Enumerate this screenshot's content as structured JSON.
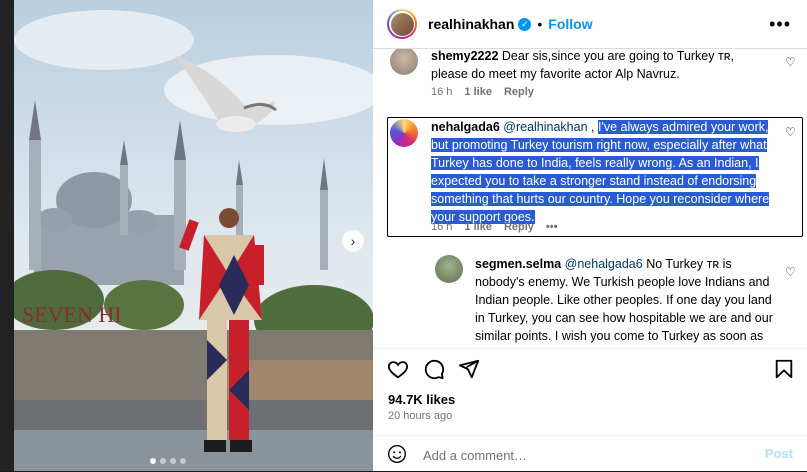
{
  "header": {
    "username": "realhinakhan",
    "separator": "•",
    "follow_label": "Follow",
    "more_label": "•••"
  },
  "media": {
    "next_icon": "chevron-right-icon",
    "sign_text": "SEVEN HI"
  },
  "comments": [
    {
      "username": "shemy2222",
      "text": "Dear sis,since you are going to Turkey ᴛʀ, please do meet my favorite actor Alp Navruz.",
      "time": "16 h",
      "likes": "1 like",
      "reply": "Reply"
    },
    {
      "username": "nehalgada6",
      "mention": "@realhinakhan",
      "separator": " , ",
      "text": "I've always admired your work, but promoting Turkey tourism right now, especially after what Turkey has done to India, feels really wrong. As an Indian, I expected you to take a stronger stand instead of endorsing something that hurts our country. Hope you reconsider where your support goes.",
      "time": "16 h",
      "likes": "1 like",
      "reply": "Reply",
      "more": "•••"
    },
    {
      "username": "segmen.selma",
      "mention": "@nehalgada6",
      "text": "No Turkey ᴛʀ is nobody's enemy. We Turkish people love Indians and Indian people. Like other peoples. If one day you land in Turkey, you can see how hospitable we are and our similar points. I wish you come to Turkey as soon as possible."
    }
  ],
  "footer": {
    "likes": "94.7K likes",
    "time": "20 hours ago",
    "add_placeholder": "Add a comment…",
    "post_label": "Post"
  },
  "colors": {
    "accent": "#0095f6",
    "highlight": "#2a5bd7",
    "mention": "#00376b"
  }
}
